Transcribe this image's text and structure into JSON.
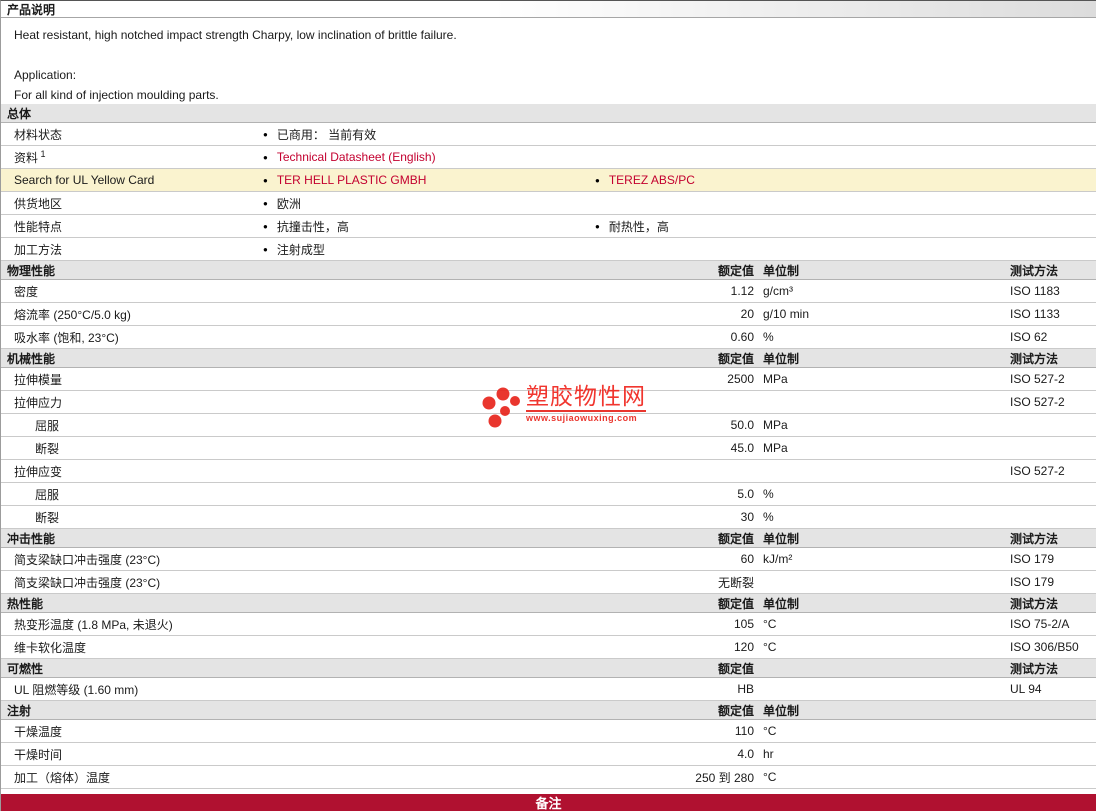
{
  "header": {
    "title": "产品说明"
  },
  "description": {
    "lines": [
      "Heat resistant, high notched impact strength Charpy, low inclination of brittle failure.",
      "",
      "Application:",
      "For all kind of injection moulding parts."
    ]
  },
  "columns": {
    "value": "额定值",
    "unit": "单位制",
    "method": "测试方法"
  },
  "general": {
    "title": "总体",
    "rows": [
      {
        "label": "材料状态",
        "items": [
          {
            "text": "已商用： 当前有效",
            "link": false
          }
        ]
      },
      {
        "label": "资料",
        "sup": "1",
        "items": [
          {
            "text": "Technical Datasheet (English)",
            "link": true
          }
        ]
      },
      {
        "label": "Search for UL Yellow Card",
        "highlight": true,
        "items": [
          {
            "text": "TER HELL PLASTIC GMBH",
            "link": true
          },
          {
            "text": "TEREZ ABS/PC",
            "link": true
          }
        ]
      },
      {
        "label": "供货地区",
        "items": [
          {
            "text": "欧洲",
            "link": false
          }
        ]
      },
      {
        "label": "性能特点",
        "items": [
          {
            "text": "抗撞击性，高",
            "link": false
          },
          {
            "text": "耐热性，高",
            "link": false
          }
        ]
      },
      {
        "label": "加工方法",
        "items": [
          {
            "text": "注射成型",
            "link": false
          }
        ]
      }
    ]
  },
  "sections": [
    {
      "title": "物理性能",
      "show_unit": true,
      "show_method": true,
      "rows": [
        {
          "label": "密度",
          "value": "1.12",
          "unit": "g/cm³",
          "method": "ISO 1183"
        },
        {
          "label": "熔流率 (250°C/5.0 kg)",
          "value": "20",
          "unit": "g/10 min",
          "method": "ISO 1133"
        },
        {
          "label": "吸水率 (饱和, 23°C)",
          "value": "0.60",
          "unit": "%",
          "method": "ISO 62"
        }
      ]
    },
    {
      "title": "机械性能",
      "show_unit": true,
      "show_method": true,
      "rows": [
        {
          "label": "拉伸模量",
          "value": "2500",
          "unit": "MPa",
          "method": "ISO 527-2"
        },
        {
          "label": "拉伸应力",
          "value": "",
          "unit": "",
          "method": "ISO 527-2"
        },
        {
          "label": "屈服",
          "indent": true,
          "value": "50.0",
          "unit": "MPa",
          "method": ""
        },
        {
          "label": "断裂",
          "indent": true,
          "value": "45.0",
          "unit": "MPa",
          "method": ""
        },
        {
          "label": "拉伸应变",
          "value": "",
          "unit": "",
          "method": "ISO 527-2"
        },
        {
          "label": "屈服",
          "indent": true,
          "value": "5.0",
          "unit": "%",
          "method": ""
        },
        {
          "label": "断裂",
          "indent": true,
          "value": "30",
          "unit": "%",
          "method": ""
        }
      ]
    },
    {
      "title": "冲击性能",
      "show_unit": true,
      "show_method": true,
      "rows": [
        {
          "label": "简支梁缺口冲击强度 (23°C)",
          "value": "60",
          "unit": "kJ/m²",
          "method": "ISO 179"
        },
        {
          "label": "简支梁缺口冲击强度 (23°C)",
          "value": "无断裂",
          "unit": "",
          "method": "ISO 179"
        }
      ]
    },
    {
      "title": "热性能",
      "show_unit": true,
      "show_method": true,
      "rows": [
        {
          "label": "热变形温度 (1.8 MPa, 未退火)",
          "value": "105",
          "unit": "°C",
          "method": "ISO 75-2/A"
        },
        {
          "label": "维卡软化温度",
          "value": "120",
          "unit": "°C",
          "method": "ISO 306/B50"
        }
      ]
    },
    {
      "title": "可燃性",
      "show_unit": false,
      "show_method": true,
      "rows": [
        {
          "label": "UL 阻燃等级 (1.60 mm)",
          "value": "HB",
          "unit": "",
          "method": "UL 94"
        }
      ]
    },
    {
      "title": "注射",
      "show_unit": true,
      "show_method": false,
      "rows": [
        {
          "label": "干燥温度",
          "value": "110",
          "unit": "°C",
          "method": ""
        },
        {
          "label": "干燥时间",
          "value": "4.0",
          "unit": "hr",
          "method": ""
        },
        {
          "label": "加工（熔体）温度",
          "value": "250 到 280",
          "unit": "°C",
          "method": ""
        }
      ]
    }
  ],
  "footer": {
    "label": "备注"
  },
  "watermark": {
    "site_name": "塑胶物性网",
    "site_url": "www.sujiaowuxing.com"
  },
  "colors": {
    "link_red": "#c3002f",
    "highlight_yellow": "#faf3cf",
    "section_bar_gray": "#e4e4e4",
    "footer_red": "#b01130",
    "watermark_red": "#e8251d"
  }
}
